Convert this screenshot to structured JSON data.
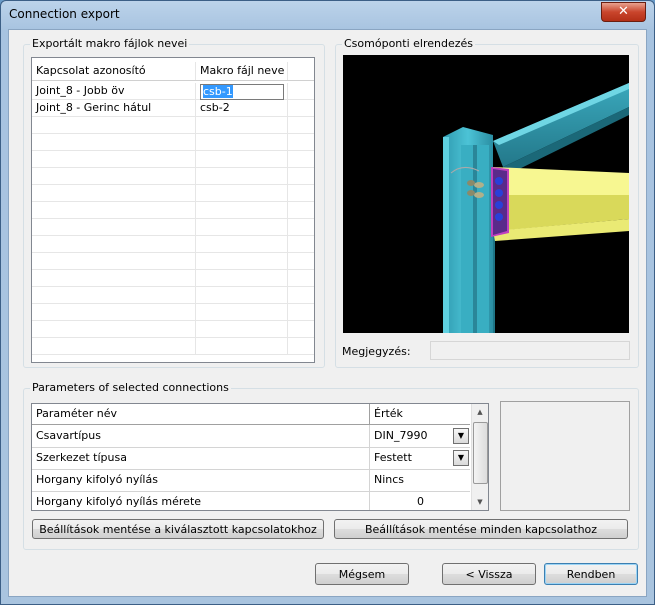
{
  "window": {
    "title": "Connection export",
    "close_symbol": "✕"
  },
  "export_group": {
    "label": "Exportált makro fájlok nevei",
    "columns": [
      "Kapcsolat azonosító",
      "Makro fájl neve"
    ],
    "rows": [
      {
        "id": "Joint_8 - Jobb öv",
        "file": "csb-1"
      },
      {
        "id": "Joint_8 - Gerinc hátul",
        "file": "csb-2"
      }
    ]
  },
  "preview_group": {
    "label": "Csomóponti elrendezés",
    "note_label": "Megjegyzés:",
    "note_value": ""
  },
  "params_group": {
    "label": "Parameters of selected connections",
    "columns": [
      "Paraméter név",
      "Érték"
    ],
    "rows": [
      {
        "name": "Csavartípus",
        "value": "DIN_7990",
        "combo": true
      },
      {
        "name": "Szerkezet típusa",
        "value": "Festett",
        "combo": true
      },
      {
        "name": "Horgany kifolyó nyílás",
        "value": "Nincs",
        "combo": false
      },
      {
        "name": "Horgany kifolyó nyílás mérete",
        "value": "0",
        "combo": false
      }
    ],
    "save_selected_label": "Beállítások mentése a kiválasztott kapcsolatokhoz",
    "save_all_label": "Beállítások mentése minden kapcsolathoz"
  },
  "footer": {
    "cancel_label": "Mégsem",
    "back_label": "< Vissza",
    "finish_label": "Rendben"
  },
  "colors": {
    "steel": "#3fb3c6",
    "beam": "#f2f27a",
    "bolt": "#2a3fd9",
    "plate": "#c040c0"
  }
}
